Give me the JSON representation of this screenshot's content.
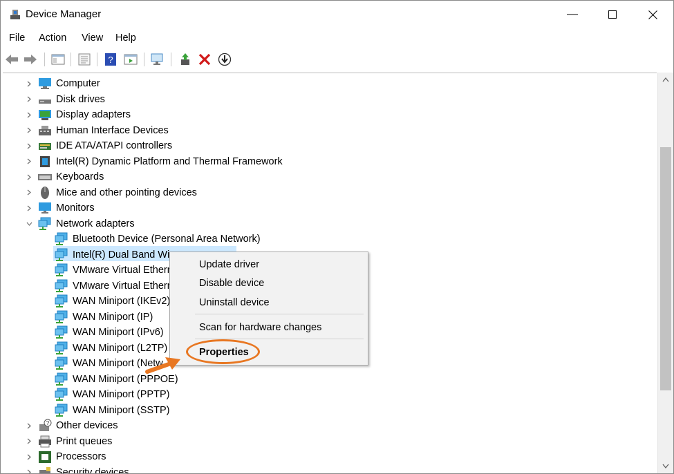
{
  "window": {
    "title": "Device Manager"
  },
  "menu": [
    "File",
    "Action",
    "View",
    "Help"
  ],
  "tree": {
    "items": [
      {
        "label": "Computer",
        "icon": "computer-icon",
        "expanded": false,
        "level": 0
      },
      {
        "label": "Disk drives",
        "icon": "disk-drive-icon",
        "expanded": false,
        "level": 0
      },
      {
        "label": "Display adapters",
        "icon": "display-adapter-icon",
        "expanded": false,
        "level": 0
      },
      {
        "label": "Human Interface Devices",
        "icon": "hid-icon",
        "expanded": false,
        "level": 0
      },
      {
        "label": "IDE ATA/ATAPI controllers",
        "icon": "ide-controller-icon",
        "expanded": false,
        "level": 0
      },
      {
        "label": "Intel(R) Dynamic Platform and Thermal Framework",
        "icon": "chip-icon",
        "expanded": false,
        "level": 0
      },
      {
        "label": "Keyboards",
        "icon": "keyboard-icon",
        "expanded": false,
        "level": 0
      },
      {
        "label": "Mice and other pointing devices",
        "icon": "mouse-icon",
        "expanded": false,
        "level": 0
      },
      {
        "label": "Monitors",
        "icon": "monitor-icon",
        "expanded": false,
        "level": 0
      },
      {
        "label": "Network adapters",
        "icon": "network-adapter-icon",
        "expanded": true,
        "level": 0
      },
      {
        "label": "Bluetooth Device (Personal Area Network)",
        "icon": "network-adapter-icon",
        "level": 1
      },
      {
        "label": "Intel(R) Dual Band Wi",
        "icon": "network-adapter-icon",
        "level": 1,
        "selected": true
      },
      {
        "label": "VMware Virtual Ethern",
        "icon": "network-adapter-icon",
        "level": 1
      },
      {
        "label": "VMware Virtual Ethern",
        "icon": "network-adapter-icon",
        "level": 1
      },
      {
        "label": "WAN Miniport (IKEv2)",
        "icon": "network-adapter-icon",
        "level": 1
      },
      {
        "label": "WAN Miniport (IP)",
        "icon": "network-adapter-icon",
        "level": 1
      },
      {
        "label": "WAN Miniport (IPv6)",
        "icon": "network-adapter-icon",
        "level": 1
      },
      {
        "label": "WAN Miniport (L2TP)",
        "icon": "network-adapter-icon",
        "level": 1
      },
      {
        "label": "WAN Miniport (Netw",
        "icon": "network-adapter-icon",
        "level": 1
      },
      {
        "label": "WAN Miniport (PPPOE)",
        "icon": "network-adapter-icon",
        "level": 1
      },
      {
        "label": "WAN Miniport (PPTP)",
        "icon": "network-adapter-icon",
        "level": 1
      },
      {
        "label": "WAN Miniport (SSTP)",
        "icon": "network-adapter-icon",
        "level": 1
      },
      {
        "label": "Other devices",
        "icon": "other-devices-icon",
        "expanded": false,
        "level": 0
      },
      {
        "label": "Print queues",
        "icon": "printer-icon",
        "expanded": false,
        "level": 0
      },
      {
        "label": "Processors",
        "icon": "processor-icon",
        "expanded": false,
        "level": 0
      },
      {
        "label": "Security devices",
        "icon": "security-device-icon",
        "expanded": false,
        "level": 0
      }
    ]
  },
  "context_menu": {
    "items": [
      "Update driver",
      "Disable device",
      "Uninstall device",
      "Scan for hardware changes",
      "Properties"
    ],
    "highlight_item": "Properties"
  },
  "colors": {
    "accent_annotation": "#e87722",
    "selection": "#cce8ff",
    "icon_blue": "#1e90d6",
    "icon_green": "#3aa23a"
  }
}
